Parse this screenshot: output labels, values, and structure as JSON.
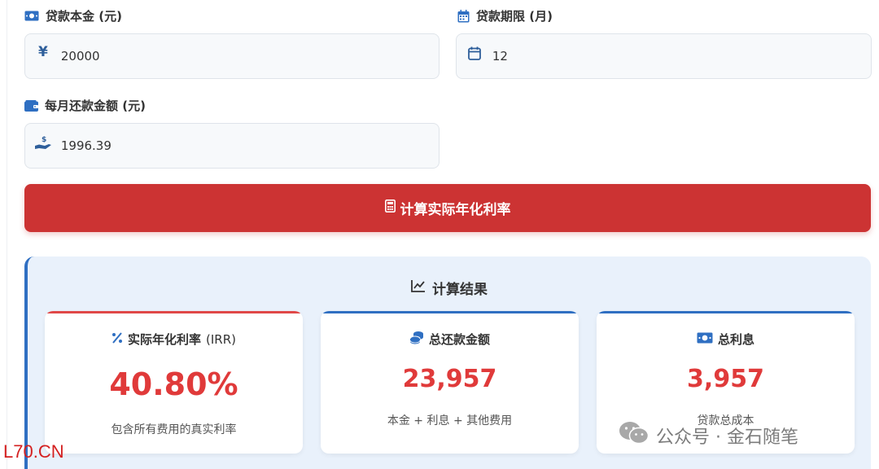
{
  "form": {
    "principal": {
      "label": "贷款本金 (元)",
      "prefix": "¥",
      "value": "20000"
    },
    "term": {
      "label": "贷款期限 (月)",
      "value": "12"
    },
    "monthly": {
      "label": "每月还款金额 (元)",
      "value": "1996.39"
    }
  },
  "calculate_button": {
    "label": "计算实际年化利率"
  },
  "results": {
    "title": "计算结果",
    "cards": [
      {
        "label": "实际年化利率",
        "label_suffix": "(IRR)",
        "value": "40.80%",
        "note": "包含所有费用的真实利率",
        "accent": "#e04848"
      },
      {
        "label": "总还款金额",
        "value": "23,957",
        "note": "本金 + 利息 + 其他费用",
        "accent": "#2f6fc2"
      },
      {
        "label": "总利息",
        "value": "3,957",
        "note": "贷款总成本",
        "accent": "#2f6fc2"
      }
    ]
  },
  "watermark": {
    "text": "公众号 · 金石随笔"
  },
  "site_mark": "L70.CN",
  "colors": {
    "primary_button": "#cc3333",
    "accent_blue": "#2f6fc2",
    "value_red": "#e03a3a",
    "panel_bg": "#e9f1fb"
  },
  "icons": {
    "principal": "money-bill-icon",
    "term": "calendar-icon",
    "monthly": "wallet-icon",
    "button": "calculator-icon",
    "results": "chart-line-icon",
    "irr": "percent-icon",
    "total": "coins-icon",
    "interest": "money-bill-icon"
  }
}
